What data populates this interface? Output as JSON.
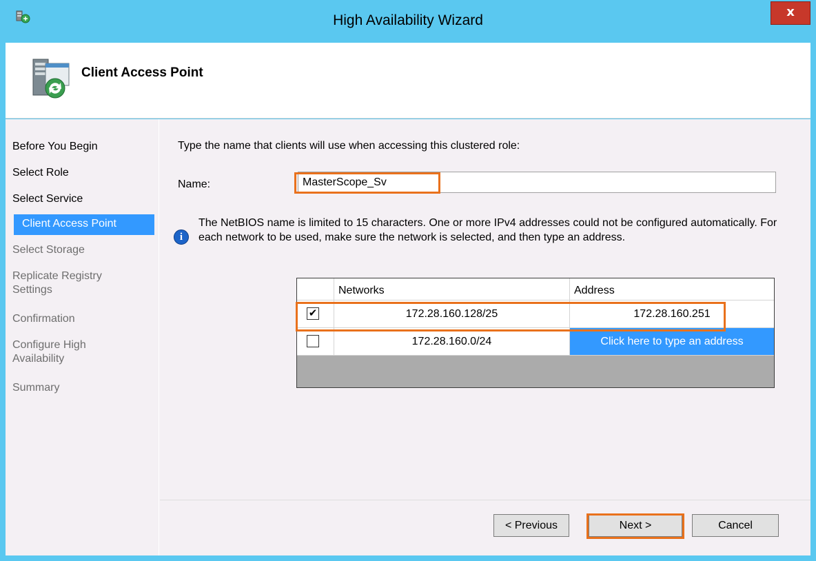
{
  "window": {
    "title": "High Availability Wizard",
    "close_label": "x",
    "app_icon": "cluster-wizard-icon"
  },
  "header": {
    "title": "Client Access Point",
    "icon": "cluster-server-icon"
  },
  "nav": {
    "items": [
      {
        "label": "Before You Begin",
        "state": "done"
      },
      {
        "label": "Select Role",
        "state": "done"
      },
      {
        "label": "Select Service",
        "state": "done"
      },
      {
        "label": "Client Access Point",
        "state": "active"
      },
      {
        "label": "Select Storage",
        "state": "disabled"
      },
      {
        "label": "Replicate Registry Settings",
        "state": "disabled"
      },
      {
        "label": "Confirmation",
        "state": "disabled"
      },
      {
        "label": "Configure High Availability",
        "state": "disabled"
      },
      {
        "label": "Summary",
        "state": "disabled"
      }
    ]
  },
  "content": {
    "instruction": "Type the name that clients will use when accessing this clustered role:",
    "name_label": "Name:",
    "name_value": "MasterScope_Sv",
    "info_text": "The NetBIOS name is limited to 15 characters.  One or more IPv4 addresses could not be configured automatically.  For each network to be used, make sure the network is selected, and then type an address.",
    "grid": {
      "columns": [
        "",
        "Networks",
        "Address"
      ],
      "rows": [
        {
          "checked": true,
          "network": "172.28.160.128/25",
          "address": "172.28.160.251"
        },
        {
          "checked": false,
          "network": "172.28.160.0/24",
          "address": "Click here to type an address"
        }
      ]
    }
  },
  "buttons": {
    "previous": "< Previous",
    "next": "Next >",
    "cancel": "Cancel"
  },
  "colors": {
    "titlebar": "#5ac8f0",
    "selection": "#3399ff",
    "highlight_box": "#e9711c",
    "close_button": "#c7382a"
  }
}
